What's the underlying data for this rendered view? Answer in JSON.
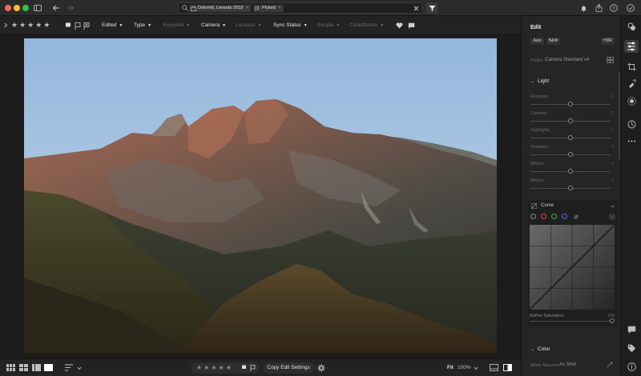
{
  "window": {
    "traffic_lights": [
      "#fe5f57",
      "#febc2e",
      "#28c840"
    ]
  },
  "search": {
    "chips": [
      {
        "label": "Dolomiti, Levanto 2018",
        "icon": "album-icon"
      },
      {
        "label": "Picked",
        "icon": "flag-icon"
      }
    ],
    "clear_icon": "close-icon"
  },
  "filter_bar": {
    "rating_stars": 5,
    "dropdowns": [
      {
        "label": "Edited",
        "enabled": true
      },
      {
        "label": "Type",
        "enabled": true
      },
      {
        "label": "Keyword",
        "enabled": false
      },
      {
        "label": "Camera",
        "enabled": true
      },
      {
        "label": "Location",
        "enabled": false
      },
      {
        "label": "Sync Status",
        "enabled": true
      },
      {
        "label": "People",
        "enabled": false
      },
      {
        "label": "Contributors",
        "enabled": false
      }
    ]
  },
  "edit_panel": {
    "title": "Edit",
    "modes": [
      "Auto",
      "B&W",
      "HDR"
    ],
    "profile_label": "Profile",
    "profile_value": "Camera Standard v4",
    "light": {
      "title": "Light",
      "sliders": [
        {
          "label": "Exposure",
          "value": "0",
          "level": 0.5
        },
        {
          "label": "Contrast",
          "value": "0",
          "level": 0.5
        },
        {
          "label": "Highlights",
          "value": "0",
          "level": 0.5
        },
        {
          "label": "Shadows",
          "value": "0",
          "level": 0.5
        },
        {
          "label": "Whites",
          "value": "0",
          "level": 0.5
        },
        {
          "label": "Blacks",
          "value": "0",
          "level": 0.5
        }
      ]
    },
    "curve": {
      "title": "Curve",
      "channel_colors": [
        "#8e8e8e",
        "#e04a4a",
        "#3fb24b",
        "#4a6be0"
      ],
      "refine_label": "Refine Saturation",
      "refine_value": "100",
      "refine_level": 1.0
    },
    "color": {
      "title": "Color",
      "white_balance_label": "White Balance",
      "white_balance_value": "As Shot"
    }
  },
  "bottom_bar": {
    "copy_label": "Copy Edit Settings",
    "fit_label": "Fit",
    "zoom_label": "100%",
    "rating_stars": 5
  }
}
